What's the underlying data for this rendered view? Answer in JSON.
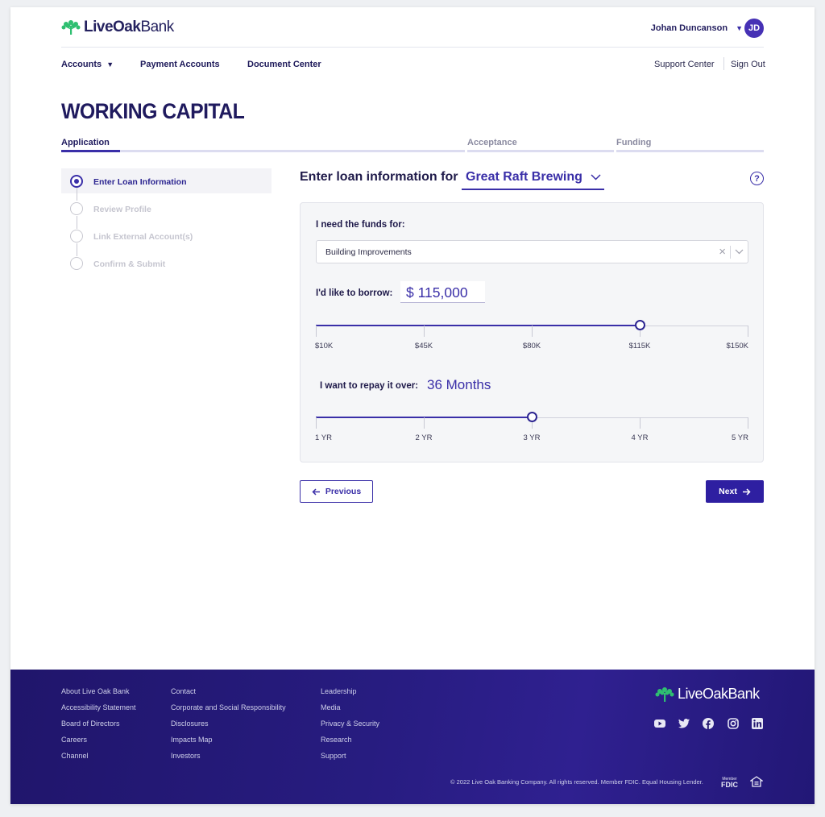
{
  "header": {
    "logo_bold": "LiveOak",
    "logo_light": "Bank",
    "user_name": "Johan Duncanson",
    "avatar_initials": "JD"
  },
  "nav": {
    "accounts": "Accounts",
    "payment_accounts": "Payment Accounts",
    "document_center": "Document Center",
    "support_center": "Support Center",
    "sign_out": "Sign Out"
  },
  "page": {
    "title": "WORKING CAPITAL"
  },
  "progress_tabs": [
    {
      "label": "Application",
      "active": true
    },
    {
      "label": "Acceptance",
      "active": false
    },
    {
      "label": "Funding",
      "active": false
    }
  ],
  "steps": [
    {
      "label": "Enter Loan Information",
      "active": true
    },
    {
      "label": "Review Profile",
      "active": false
    },
    {
      "label": "Link External Account(s)",
      "active": false
    },
    {
      "label": "Confirm & Submit",
      "active": false
    }
  ],
  "form": {
    "heading": "Enter loan information for",
    "business": "Great Raft Brewing",
    "funds_label": "I need the funds for:",
    "funds_value": "Building Improvements",
    "borrow_label": "I'd like to borrow:",
    "borrow_amount": "$ 115,000",
    "borrow_value": 115000,
    "borrow_min": 10000,
    "borrow_max": 150000,
    "borrow_ticks": [
      {
        "label": "$10K",
        "value": 10000
      },
      {
        "label": "$45K",
        "value": 45000
      },
      {
        "label": "$80K",
        "value": 80000
      },
      {
        "label": "$115K",
        "value": 115000
      },
      {
        "label": "$150K",
        "value": 150000
      }
    ],
    "repay_label": "I want to repay it over:",
    "repay_display": "36 Months",
    "repay_value": 3,
    "repay_min": 1,
    "repay_max": 5,
    "repay_ticks": [
      {
        "label": "1 YR",
        "value": 1
      },
      {
        "label": "2 YR",
        "value": 2
      },
      {
        "label": "3 YR",
        "value": 3
      },
      {
        "label": "4 YR",
        "value": 4
      },
      {
        "label": "5 YR",
        "value": 5
      }
    ],
    "previous": "Previous",
    "next": "Next"
  },
  "footer": {
    "col1": [
      "About Live Oak Bank",
      "Accessibility Statement",
      "Board of Directors",
      "Careers",
      "Channel"
    ],
    "col2": [
      "Contact",
      "Corporate and Social Responsibility",
      "Disclosures",
      "Impacts Map",
      "Investors"
    ],
    "col3": [
      "Leadership",
      "Media",
      "Privacy & Security",
      "Research",
      "Support"
    ],
    "copyright": "© 2022 Live Oak Banking Company. All rights reserved. Member FDIC. Equal Housing Lender.",
    "fdic_member": "Member",
    "fdic": "FDIC"
  },
  "colors": {
    "brand": "#3a2fa8",
    "footer": "#21166f",
    "logo_green": "#2fbf71"
  }
}
